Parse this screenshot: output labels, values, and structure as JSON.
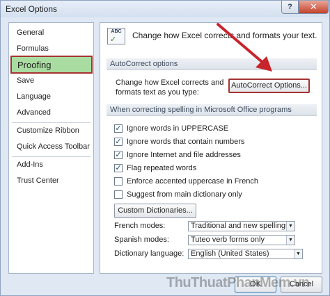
{
  "window": {
    "title": "Excel Options",
    "help_glyph": "?",
    "close_glyph": "✕"
  },
  "nav": {
    "items": [
      "General",
      "Formulas",
      "Proofing",
      "Save",
      "Language",
      "Advanced",
      "Customize Ribbon",
      "Quick Access Toolbar",
      "Add-Ins",
      "Trust Center"
    ],
    "selected": "Proofing"
  },
  "content": {
    "icon_text": "ABC",
    "icon_check": "✓",
    "intro": "Change how Excel corrects and formats your text.",
    "autocorrect_header": "AutoCorrect options",
    "autocorrect_desc": [
      "Change how Excel corrects and",
      "formats text as you type:"
    ],
    "autocorrect_button": "AutoCorrect Options...",
    "spelling_header": "When correcting spelling in Microsoft Office programs",
    "checkboxes": [
      {
        "label": "Ignore words in UPPERCASE",
        "checked": true,
        "enabled": true
      },
      {
        "label": "Ignore words that contain numbers",
        "checked": true,
        "enabled": true
      },
      {
        "label": "Ignore Internet and file addresses",
        "checked": true,
        "enabled": true
      },
      {
        "label": "Flag repeated words",
        "checked": true,
        "enabled": true
      },
      {
        "label": "Enforce accented uppercase in French",
        "checked": false,
        "enabled": true
      },
      {
        "label": "Suggest from main dictionary only",
        "checked": false,
        "enabled": true
      }
    ],
    "custom_dict_button": "Custom Dictionaries...",
    "french_modes_label": "French modes:",
    "french_modes_value": "Traditional and new spellings",
    "spanish_modes_label": "Spanish modes:",
    "spanish_modes_value": "Tuteo verb forms only",
    "dict_lang_label": "Dictionary language:",
    "dict_lang_value": "English (United States)"
  },
  "footer": {
    "ok": "OK",
    "cancel": "Cancel"
  },
  "watermark": "ThuThuatPhanMem.vn",
  "colors": {
    "selection_green": "#a9dca0",
    "highlight_red": "#a43232",
    "arrow_red": "#c8242c"
  }
}
